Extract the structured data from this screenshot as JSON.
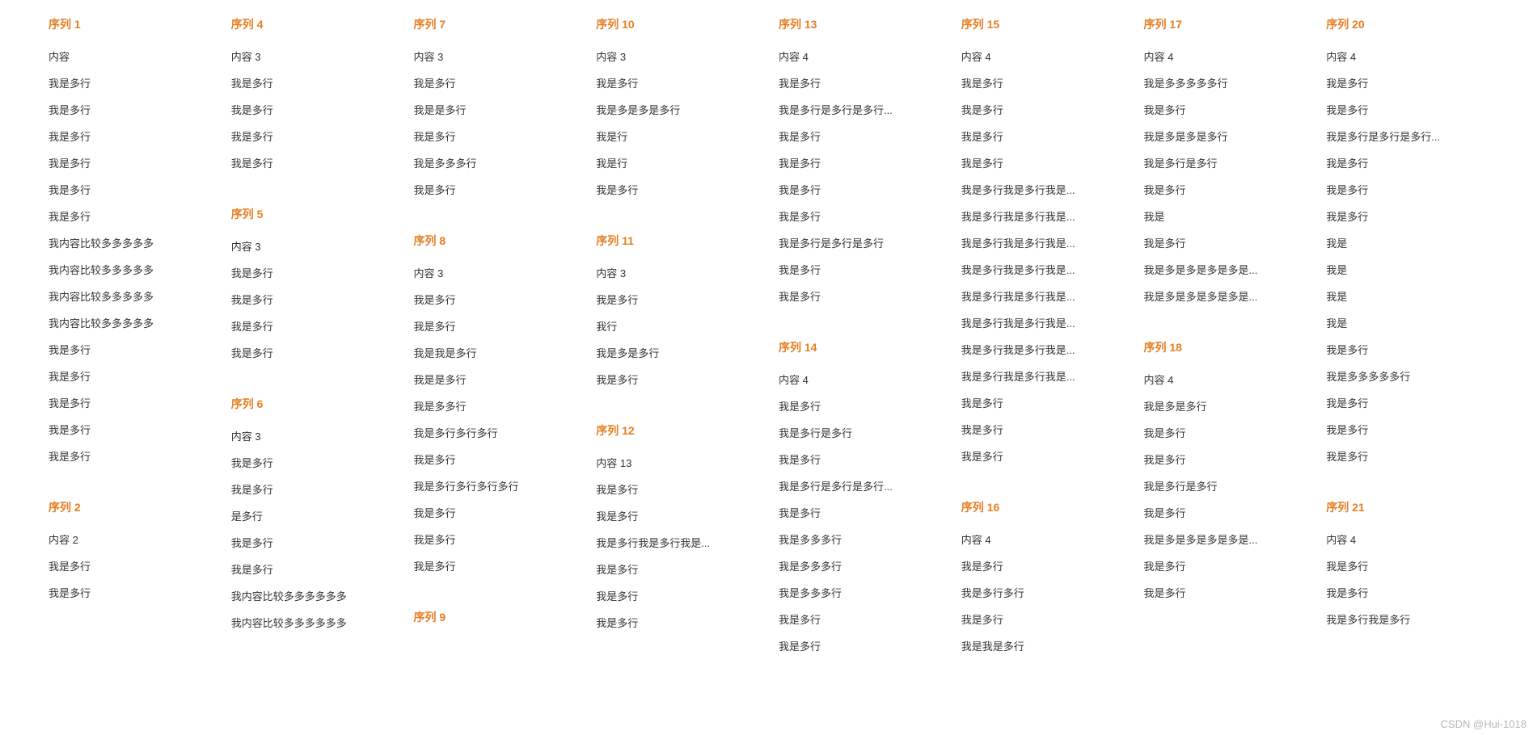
{
  "watermark": "CSDN @Hui-1018",
  "sections": [
    {
      "title": "序列 1",
      "items": [
        "内容",
        "我是多行",
        "我是多行",
        "我是多行",
        "我是多行",
        "我是多行",
        "我是多行",
        "我内容比较多多多多多",
        "我内容比较多多多多多",
        "我内容比较多多多多多",
        "我内容比较多多多多多",
        "我是多行",
        "我是多行",
        "我是多行",
        "我是多行",
        "我是多行"
      ]
    },
    {
      "title": "序列 2",
      "items": [
        "内容 2",
        "我是多行",
        "我是多行"
      ]
    },
    {
      "title": "序列 4",
      "items": [
        "内容 3",
        "我是多行",
        "我是多行",
        "我是多行",
        "我是多行"
      ]
    },
    {
      "title": "序列 5",
      "items": [
        "内容 3",
        "我是多行",
        "我是多行",
        "我是多行",
        "我是多行"
      ]
    },
    {
      "title": "序列 6",
      "items": [
        "内容 3",
        "我是多行",
        "我是多行",
        "是多行",
        "我是多行",
        "我是多行",
        "我内容比较多多多多多多",
        "我内容比较多多多多多多"
      ]
    },
    {
      "title": "序列 7",
      "items": [
        "内容 3",
        "我是多行",
        "我是是多行",
        "我是多行",
        "我是多多多行",
        "我是多行"
      ]
    },
    {
      "title": "序列 8",
      "items": [
        "内容 3",
        "我是多行",
        "我是多行",
        "我是我是多行",
        "我是是多行",
        "我是多多行",
        "我是多行多行多行",
        "我是多行",
        "我是多行多行多行多行",
        "我是多行",
        "我是多行",
        "我是多行"
      ]
    },
    {
      "title": "序列 9",
      "items": []
    },
    {
      "title": "序列 10",
      "items": [
        "内容 3",
        "我是多行",
        "我是多是多是多行",
        "我是行",
        "我是行",
        "我是多行"
      ]
    },
    {
      "title": "序列 11",
      "items": [
        "内容 3",
        "我是多行",
        "我行",
        "我是多是多行",
        "我是多行"
      ]
    },
    {
      "title": "序列 12",
      "items": [
        "内容 13",
        "我是多行",
        "我是多行",
        "我是多行我是多行我是...",
        "我是多行",
        "我是多行",
        "我是多行"
      ]
    },
    {
      "title": "序列 13",
      "items": [
        "内容 4",
        "我是多行",
        "我是多行是多行是多行...",
        "我是多行",
        "我是多行",
        "我是多行",
        "我是多行",
        "我是多行是多行是多行",
        "我是多行",
        "我是多行"
      ]
    },
    {
      "title": "序列 14",
      "items": [
        "内容 4",
        "我是多行",
        "我是多行是多行",
        "我是多行",
        "我是多行是多行是多行...",
        "我是多行",
        "我是多多多行",
        "我是多多多行",
        "我是多多多行",
        "我是多行",
        "我是多行"
      ]
    },
    {
      "title": "序列 15",
      "items": [
        "内容 4",
        "我是多行",
        "我是多行",
        "我是多行",
        "我是多行",
        "我是多行我是多行我是...",
        "我是多行我是多行我是...",
        "我是多行我是多行我是...",
        "我是多行我是多行我是...",
        "我是多行我是多行我是...",
        "我是多行我是多行我是...",
        "我是多行我是多行我是...",
        "我是多行我是多行我是...",
        "我是多行",
        "我是多行",
        "我是多行"
      ]
    },
    {
      "title": "序列 16",
      "items": [
        "内容 4",
        "我是多行",
        "我是多行多行",
        "我是多行",
        "我是我是多行"
      ]
    },
    {
      "title": "序列 17",
      "items": [
        "内容 4",
        "我是多多多多多行",
        "我是多行",
        "我是多是多是多行",
        "我是多行是多行",
        "我是多行",
        "我是",
        "我是多行",
        "我是多是多是多是多是...",
        "我是多是多是多是多是..."
      ]
    },
    {
      "title": "序列 18",
      "items": [
        "内容 4",
        "我是多是多行",
        "我是多行",
        "我是多行",
        "我是多行是多行",
        "我是多行",
        "我是多是多是多是多是...",
        "我是多行",
        "我是多行"
      ]
    },
    {
      "title": "序列 20",
      "items": [
        "内容 4",
        "我是多行",
        "我是多行",
        "我是多行是多行是多行...",
        "我是多行",
        "我是多行",
        "我是多行",
        "我是",
        "我是",
        "我是",
        "我是",
        "我是多行",
        "我是多多多多多行",
        "我是多行",
        "我是多行",
        "我是多行"
      ]
    },
    {
      "title": "序列 21",
      "items": [
        "内容 4",
        "我是多行",
        "我是多行",
        "我是多行我是多行"
      ]
    }
  ]
}
